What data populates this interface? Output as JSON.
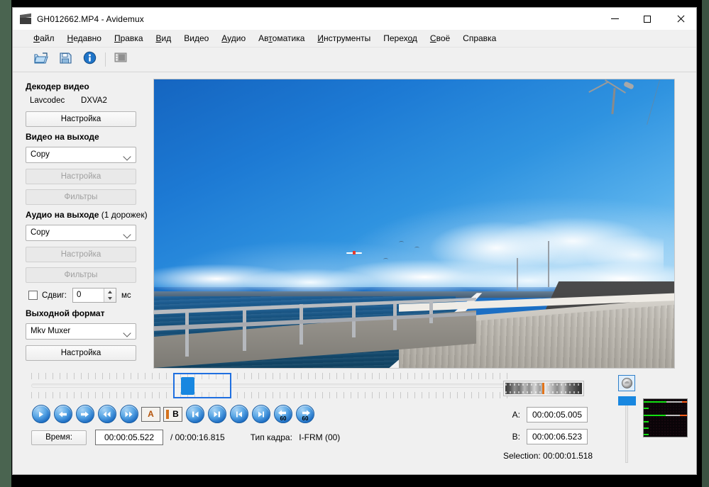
{
  "window": {
    "title": "GH012662.MP4 - Avidemux",
    "app_icon": "clapperboard-icon",
    "minimize": "–",
    "maximize": "□",
    "close": "✕"
  },
  "menubar": {
    "items": [
      {
        "label": "Файл",
        "accel": "Ф"
      },
      {
        "label": "Недавно",
        "accel": "Н"
      },
      {
        "label": "Правка",
        "accel": "П"
      },
      {
        "label": "Вид",
        "accel": "В"
      },
      {
        "label": "Видео",
        "accel": ""
      },
      {
        "label": "Аудио",
        "accel": "А"
      },
      {
        "label": "Автоматика",
        "accel": "т"
      },
      {
        "label": "Инструменты",
        "accel": "И"
      },
      {
        "label": "Переход",
        "accel": "о"
      },
      {
        "label": "Своё",
        "accel": "С"
      },
      {
        "label": "Справка",
        "accel": ""
      }
    ]
  },
  "toolbar": {
    "buttons": [
      {
        "name": "open-file-button",
        "icon": "open-folder-icon",
        "tooltip": "Открыть"
      },
      {
        "name": "save-file-button",
        "icon": "floppy-save-icon",
        "tooltip": "Сохранить"
      },
      {
        "name": "info-button",
        "icon": "info-circle-icon",
        "tooltip": "Свойства"
      },
      {
        "name": "calculator-button",
        "icon": "film-strip-icon",
        "tooltip": "Калькулятор"
      }
    ]
  },
  "left_panel": {
    "video_decoder": {
      "title": "Декодер видео",
      "codec": "Lavcodec",
      "accel": "DXVA2",
      "configure_label": "Настройка"
    },
    "video_output": {
      "title": "Видео на выходе",
      "codec_selected": "Copy",
      "configure_label": "Настройка",
      "filters_label": "Фильтры",
      "configure_disabled": true,
      "filters_disabled": true
    },
    "audio_output": {
      "title": "Аудио на выходе",
      "subtitle": "(1 дорожек)",
      "codec_selected": "Copy",
      "configure_label": "Настройка",
      "filters_label": "Фильтры",
      "configure_disabled": true,
      "filters_disabled": true,
      "shift_label": "Сдвиг:",
      "shift_value": "0",
      "shift_unit": "мс",
      "shift_checked": false
    },
    "output_format": {
      "title": "Выходной формат",
      "muxer_selected": "Mkv Muxer",
      "configure_label": "Настройка"
    }
  },
  "preview": {
    "description": "Кадр видео: мост через море, дорожное ограждение и бетонный отбойник, голубое небо с облаками"
  },
  "navigation": {
    "buttons": [
      {
        "name": "play-button",
        "icon": "play-icon"
      },
      {
        "name": "step-back-button",
        "icon": "arrow-left-icon"
      },
      {
        "name": "step-forward-button",
        "icon": "arrow-right-icon"
      },
      {
        "name": "rewind-button",
        "icon": "double-arrow-left-icon"
      },
      {
        "name": "fast-forward-button",
        "icon": "double-arrow-right-icon"
      },
      {
        "name": "mark-a-button",
        "icon": "marker-a-icon",
        "label": "A"
      },
      {
        "name": "mark-b-button",
        "icon": "marker-b-icon",
        "label": "B"
      },
      {
        "name": "prev-keyframe-button",
        "icon": "skip-to-start-icon"
      },
      {
        "name": "next-keyframe-button",
        "icon": "skip-to-end-icon"
      },
      {
        "name": "go-to-start-button",
        "icon": "jump-start-icon"
      },
      {
        "name": "go-to-end-button",
        "icon": "jump-end-icon"
      },
      {
        "name": "back-60-button",
        "icon": "back-60-icon",
        "label": "60"
      },
      {
        "name": "forward-60-button",
        "icon": "forward-60-icon",
        "label": "60"
      }
    ]
  },
  "status": {
    "time_button": "Время:",
    "current_time": "00:00:05.522",
    "total_time": "/ 00:00:16.815",
    "frame_type_label": "Тип кадра:",
    "frame_type_value": "I-FRM (00)"
  },
  "markers": {
    "a_label": "A:",
    "a_value": "00:00:05.005",
    "b_label": "B:",
    "b_value": "00:00:06.523",
    "selection": "Selection: 00:00:01.518"
  },
  "volume": {
    "icon": "speaker-knob-icon",
    "level_percent": 100
  },
  "colors": {
    "accent_blue": "#1887e0",
    "marker_orange": "#d4711c",
    "vu_green": "#13e013",
    "window_bg": "#f0f0f0"
  }
}
